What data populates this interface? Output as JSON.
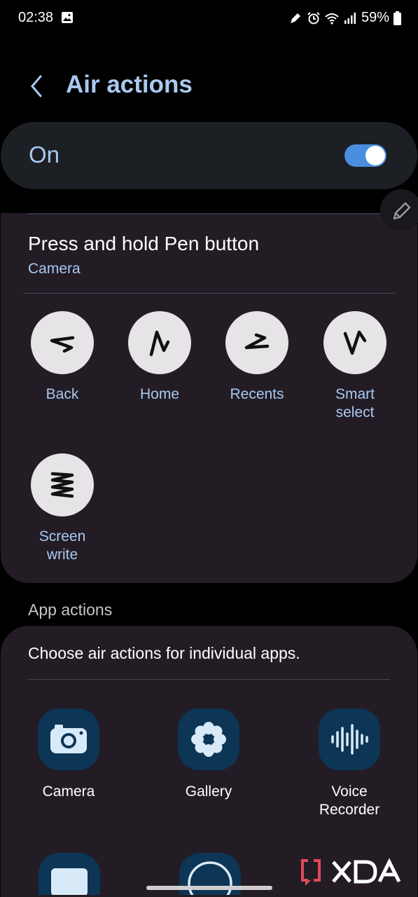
{
  "status": {
    "time": "02:38",
    "battery": "59%"
  },
  "header": {
    "title": "Air actions"
  },
  "master": {
    "label": "On",
    "enabled": true
  },
  "pen_card": {
    "title": "Press and hold Pen button",
    "subtitle": "Camera",
    "gestures": [
      {
        "label": "Back"
      },
      {
        "label": "Home"
      },
      {
        "label": "Recents"
      },
      {
        "label": "Smart select"
      },
      {
        "label": "Screen write"
      }
    ]
  },
  "app_actions": {
    "header": "App actions",
    "description": "Choose air actions for individual apps.",
    "apps": [
      {
        "label": "Camera"
      },
      {
        "label": "Gallery"
      },
      {
        "label": "Voice Recorder"
      }
    ]
  },
  "colors": {
    "accent": "#a9c9f0",
    "toggle": "#4a8ee0",
    "card": "#231c25",
    "app_icon_bg": "#0d3555"
  }
}
